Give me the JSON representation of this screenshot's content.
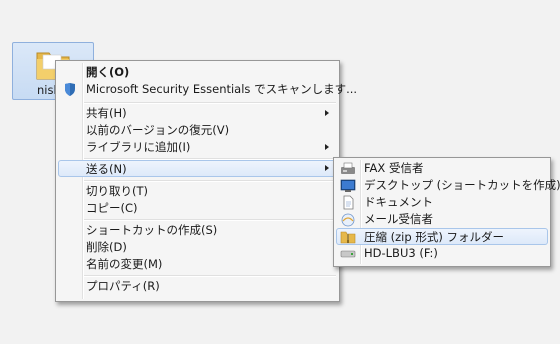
{
  "desktop": {
    "folder_label": "nish"
  },
  "context_menu": {
    "open": "開く(O)",
    "mse_scan": "Microsoft Security Essentials でスキャンします...",
    "share": "共有(H)",
    "restore_versions": "以前のバージョンの復元(V)",
    "add_to_library": "ライブラリに追加(I)",
    "send_to": "送る(N)",
    "cut": "切り取り(T)",
    "copy": "コピー(C)",
    "create_shortcut": "ショートカットの作成(S)",
    "delete": "削除(D)",
    "rename": "名前の変更(M)",
    "properties": "プロパティ(R)"
  },
  "send_to_menu": {
    "fax": "FAX 受信者",
    "desktop_shortcut": "デスクトップ (ショートカットを作成)",
    "documents": "ドキュメント",
    "mail_recipient": "メール受信者",
    "zip_folder": "圧縮 (zip 形式) フォルダー",
    "drive": "HD-LBU3 (F:)"
  },
  "icons": {
    "folder": "folder-icon",
    "shield": "security-shield-icon",
    "fax": "fax-icon",
    "desktop": "desktop-icon",
    "document": "document-icon",
    "mail": "mail-icon",
    "zip": "zip-folder-icon",
    "drive": "drive-icon"
  },
  "colors": {
    "highlight_border": "#a9c6ea",
    "folder_selection": "#c7dbf3"
  }
}
